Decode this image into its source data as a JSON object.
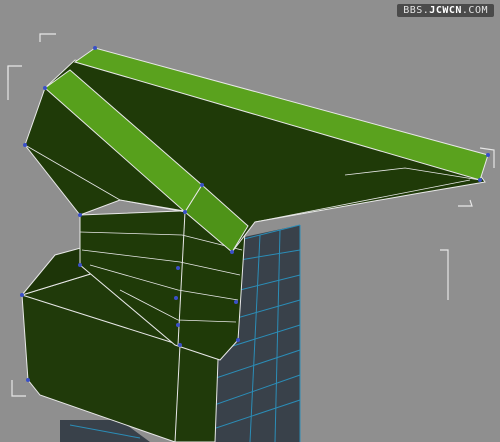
{
  "viewport": {
    "watermark_prefix": "BBS.",
    "watermark_brand": "JCWCN",
    "watermark_suffix": ".COM"
  },
  "colors": {
    "background": "#8f8f8f",
    "dark_face": "#1f3a08",
    "light_face": "#5aa21e",
    "edge": "#e8e8e8",
    "vertex": "#3a50c8",
    "wire": "#2b8db7"
  }
}
